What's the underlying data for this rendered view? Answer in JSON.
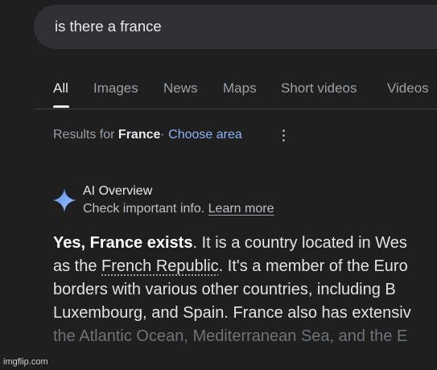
{
  "search": {
    "query": "is there a france"
  },
  "tabs": [
    {
      "label": "All",
      "active": true
    },
    {
      "label": "Images"
    },
    {
      "label": "News"
    },
    {
      "label": "Maps"
    },
    {
      "label": "Short videos"
    },
    {
      "label": "Videos"
    }
  ],
  "results": {
    "prefix": "Results for",
    "location": "France",
    "separator": "·",
    "choose_area": "Choose area"
  },
  "ai_overview": {
    "title": "AI Overview",
    "subtitle": "Check important info.",
    "learn_more": "Learn more",
    "icon": "gemini-sparkle-icon",
    "accent_color": "#8ab4f8",
    "lines": [
      {
        "bold": "Yes, France exists",
        "rest": ". It is a country located in Wes"
      },
      {
        "pre": "as the ",
        "link": "French Republic",
        "rest": ". It's a member of the Euro"
      },
      {
        "text": "borders with various other countries, including B"
      },
      {
        "text": "Luxembourg, and Spain. France also has extensiv"
      },
      {
        "text": "the Atlantic Ocean, Mediterranean Sea, and the E"
      }
    ]
  },
  "watermark": "imgflip.com"
}
